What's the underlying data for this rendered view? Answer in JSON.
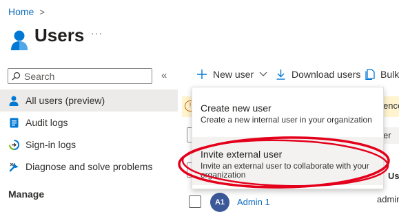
{
  "breadcrumb": {
    "home": "Home",
    "separator": ">"
  },
  "page": {
    "title": "Users",
    "more": "···"
  },
  "search": {
    "placeholder": "Search"
  },
  "nav": {
    "collapse": "«",
    "items": [
      {
        "label": "All users (preview)",
        "icon": "user-icon",
        "active": true
      },
      {
        "label": "Audit logs",
        "icon": "audit-log-icon"
      },
      {
        "label": "Sign-in logs",
        "icon": "sign-in-log-icon"
      },
      {
        "label": "Diagnose and solve problems",
        "icon": "wrench-icon"
      }
    ],
    "section_manage": "Manage"
  },
  "toolbar": {
    "new_user": "New user",
    "download_users": "Download users",
    "bulk": "Bulk"
  },
  "dropdown": {
    "items": [
      {
        "title": "Create new user",
        "description": "Create a new internal user in your organization"
      },
      {
        "title": "Invite external user",
        "description": "Invite an external user to collaborate with your organization"
      }
    ]
  },
  "background": {
    "banner_text": "ence",
    "filter_text": "er",
    "column_header": "Use",
    "avatar_initials": "A1",
    "row_name": "Admin 1",
    "row_upn": "admin"
  },
  "colors": {
    "accent": "#0f6cbd",
    "annotation": "#e4001b",
    "active_nav": "#edebe9"
  }
}
